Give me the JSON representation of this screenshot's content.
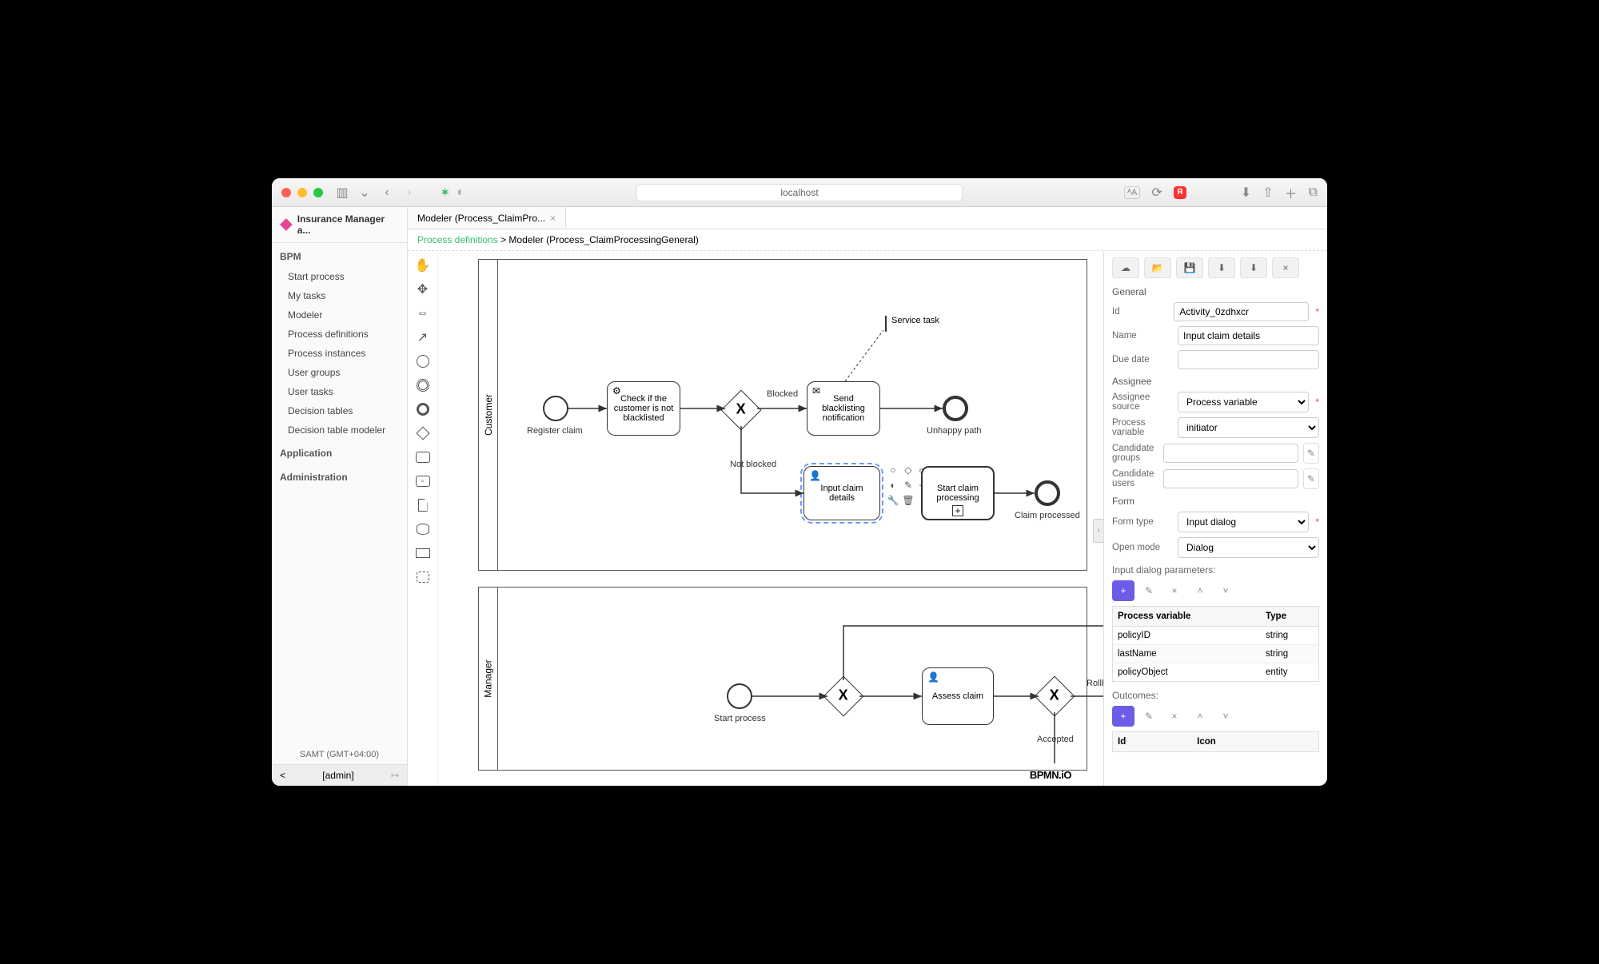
{
  "browser": {
    "url": "localhost"
  },
  "app": {
    "title": "Insurance Manager a..."
  },
  "sidebar": {
    "sections": {
      "bpm": "BPM",
      "app": "Application",
      "admin": "Administration"
    },
    "items": [
      "Start process",
      "My tasks",
      "Modeler",
      "Process definitions",
      "Process instances",
      "User groups",
      "User tasks",
      "Decision tables",
      "Decision table modeler"
    ],
    "tz": "SAMT (GMT+04:00)",
    "user": "[admin]"
  },
  "tabs": {
    "active": "Modeler (Process_ClaimPro..."
  },
  "crumbs": {
    "root": "Process definitions",
    "sep": ">",
    "current": "Modeler (Process_ClaimProcessingGeneral)"
  },
  "diagram": {
    "lane1": "Customer",
    "lane2": "Manager",
    "registerClaim": "Register claim",
    "checkBlacklist": "Check if the customer is not blacklisted",
    "blocked": "Blocked",
    "notBlocked": "Not blocked",
    "sendNotif": "Send blacklisting notification",
    "unhappy": "Unhappy path",
    "inputClaim": "Input claim details",
    "startClaim": "Start claim processing",
    "claimProcessed": "Claim processed",
    "serviceTask": "Service task",
    "startProcess": "Start process",
    "assessClaim": "Assess claim",
    "rollback": "Rollback",
    "accepted": "Accepted",
    "watermark": "BPMN.iO"
  },
  "props": {
    "general": "General",
    "idLabel": "Id",
    "idValue": "Activity_0zdhxcr",
    "nameLabel": "Name",
    "nameValue": "Input claim details",
    "dueLabel": "Due date",
    "assignee": "Assignee",
    "srcLabel": "Assignee source",
    "srcValue": "Process variable",
    "pvLabel": "Process variable",
    "pvValue": "initiator",
    "cgLabel": "Candidate groups",
    "cuLabel": "Candidate users",
    "form": "Form",
    "ftLabel": "Form type",
    "ftValue": "Input dialog",
    "omLabel": "Open mode",
    "omValue": "Dialog",
    "idp": "Input dialog parameters:",
    "tblH1": "Process variable",
    "tblH2": "Type",
    "rows": [
      {
        "v": "policyID",
        "t": "string"
      },
      {
        "v": "lastName",
        "t": "string"
      },
      {
        "v": "policyObject",
        "t": "entity"
      }
    ],
    "outcomes": "Outcomes:",
    "outH1": "Id",
    "outH2": "Icon"
  }
}
